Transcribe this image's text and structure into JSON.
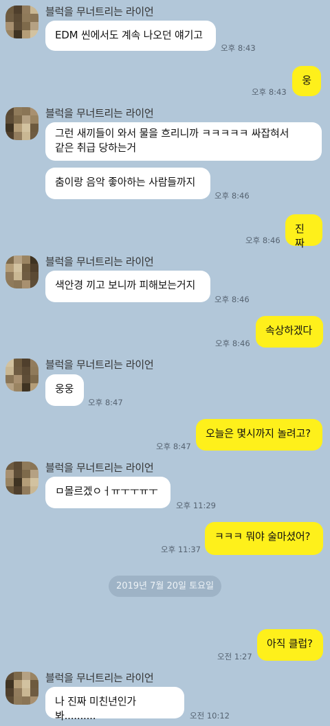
{
  "sender_name": "블럭을 무너트리는 라이언",
  "messages": [
    {
      "text": "EDM 씬에서도 계속 나오던 얘기고",
      "time": "오후 8:43"
    },
    {
      "text": "웅",
      "time": "오후 8:43"
    },
    {
      "text": "그런 새끼들이 와서 물을 흐리니까 ㅋㅋㅋㅋㅋ 싸잡혀서\n같은 취급 당하는거"
    },
    {
      "text": "춤이랑 음악 좋아하는 사람들까지",
      "time": "오후 8:46"
    },
    {
      "text": "진짜",
      "time": "오후 8:46"
    },
    {
      "text": "색안경 끼고 보니까 피해보는거지",
      "time": "오후 8:46"
    },
    {
      "text": "속상하겠다",
      "time": "오후 8:46"
    },
    {
      "text": "웅웅",
      "time": "오후 8:47"
    },
    {
      "text": "오늘은 몇시까지 놀려고?",
      "time": "오후 8:47"
    },
    {
      "text": "ㅁ몰르겠ㅇㅓㅠㅜㅜㅠㅜ",
      "time": "오후 11:29"
    },
    {
      "text": "ㅋㅋㅋ 뭐야 술마셨어?",
      "time": "오후 11:37"
    },
    {
      "text": "아직 클럽?",
      "time": "오전 1:27"
    },
    {
      "text": "나 진짜 미친년인가봐..........",
      "time": "오전 10:12"
    }
  ],
  "date_divider": "2019년 7월 20일 토요일"
}
